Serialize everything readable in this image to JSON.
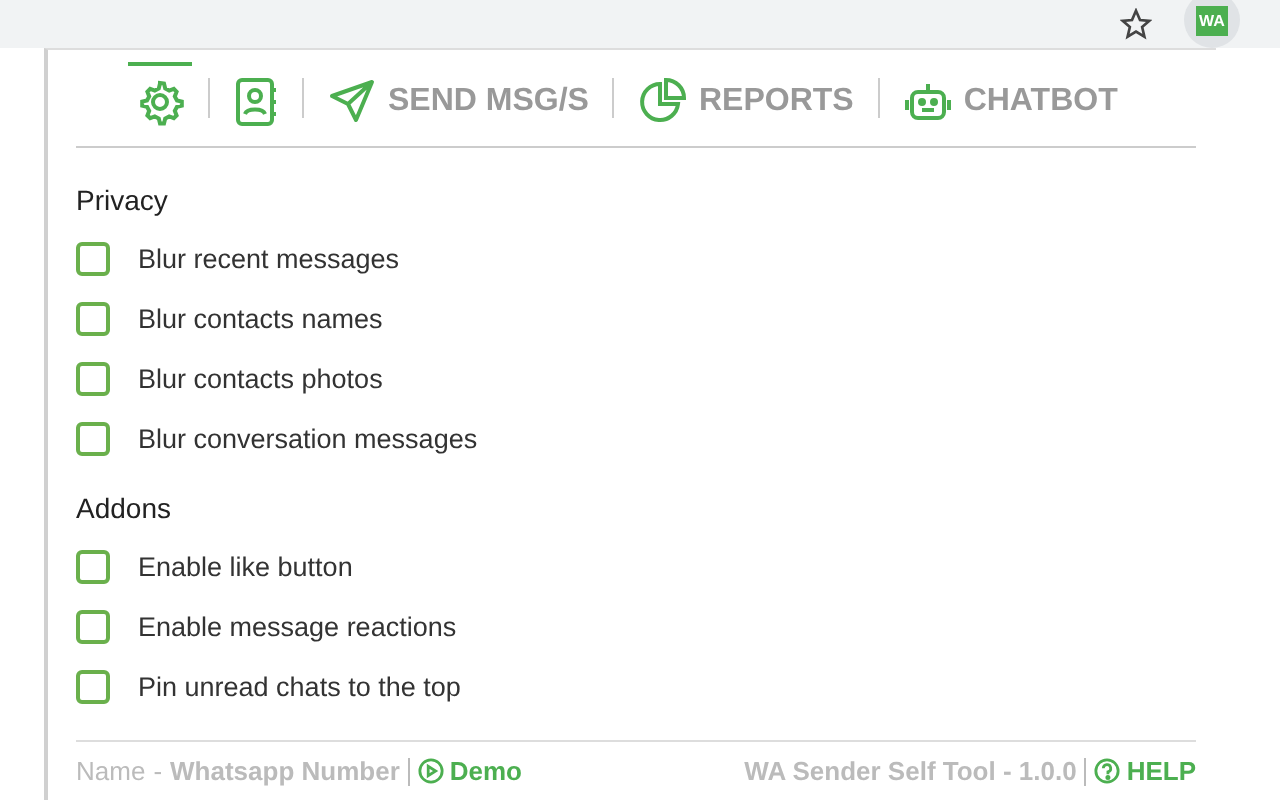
{
  "browser": {
    "extension_badge": "WA"
  },
  "tabs": [
    {
      "kind": "settings",
      "selected": true
    },
    {
      "kind": "contacts",
      "selected": false
    },
    {
      "kind": "send",
      "label": "SEND MSG/S",
      "selected": false
    },
    {
      "kind": "reports",
      "label": "REPORTS",
      "selected": false
    },
    {
      "kind": "chatbot",
      "label": "CHATBOT",
      "selected": false
    }
  ],
  "sections": [
    {
      "title": "Privacy",
      "options": [
        {
          "label": "Blur recent messages",
          "checked": false
        },
        {
          "label": "Blur contacts names",
          "checked": false
        },
        {
          "label": "Blur contacts photos",
          "checked": false
        },
        {
          "label": "Blur conversation messages",
          "checked": false
        }
      ]
    },
    {
      "title": "Addons",
      "options": [
        {
          "label": "Enable like button",
          "checked": false
        },
        {
          "label": "Enable message reactions",
          "checked": false
        },
        {
          "label": "Pin unread chats to the top",
          "checked": false
        }
      ]
    }
  ],
  "footer": {
    "name": "Name",
    "separator": "-",
    "number": "Whatsapp Number",
    "demo": "Demo",
    "version": "WA Sender Self Tool - 1.0.0",
    "help": "HELP"
  }
}
